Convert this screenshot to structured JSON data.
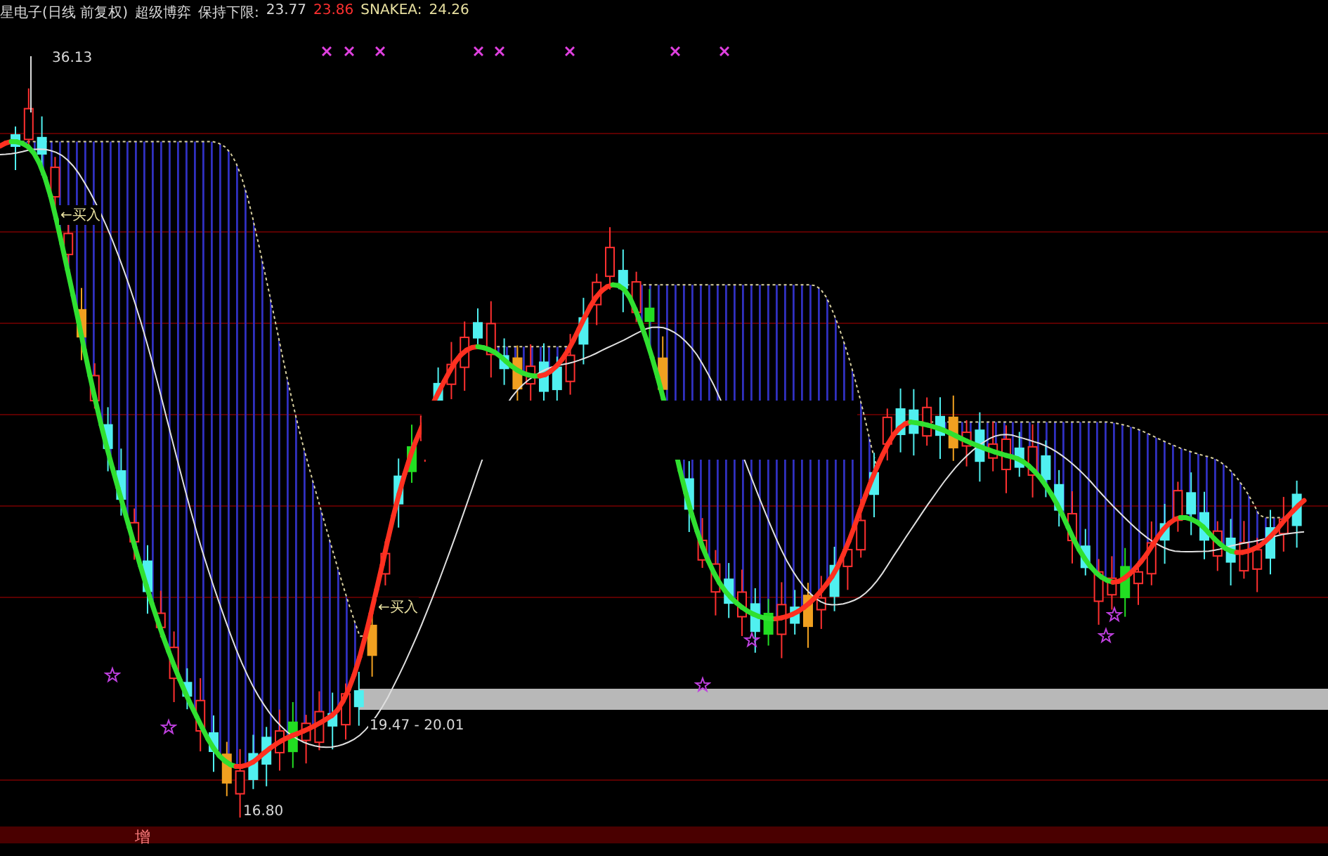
{
  "header": {
    "title": "星电子(日线 前复权)",
    "indicator": "超级博弈",
    "lower_label": "保持下限:",
    "lower_value": "23.77",
    "red_value": "23.86",
    "snake_label": "SNAKEA:",
    "snake_value": "24.26"
  },
  "annotations": [
    {
      "kind": "high",
      "text": "36.13"
    },
    {
      "kind": "buy",
      "text": "←买入"
    },
    {
      "kind": "buy",
      "text": "←买入"
    },
    {
      "kind": "range",
      "text": "19.47 - 20.01"
    },
    {
      "kind": "low",
      "text": "16.80"
    }
  ],
  "footer_mark": "增"
}
